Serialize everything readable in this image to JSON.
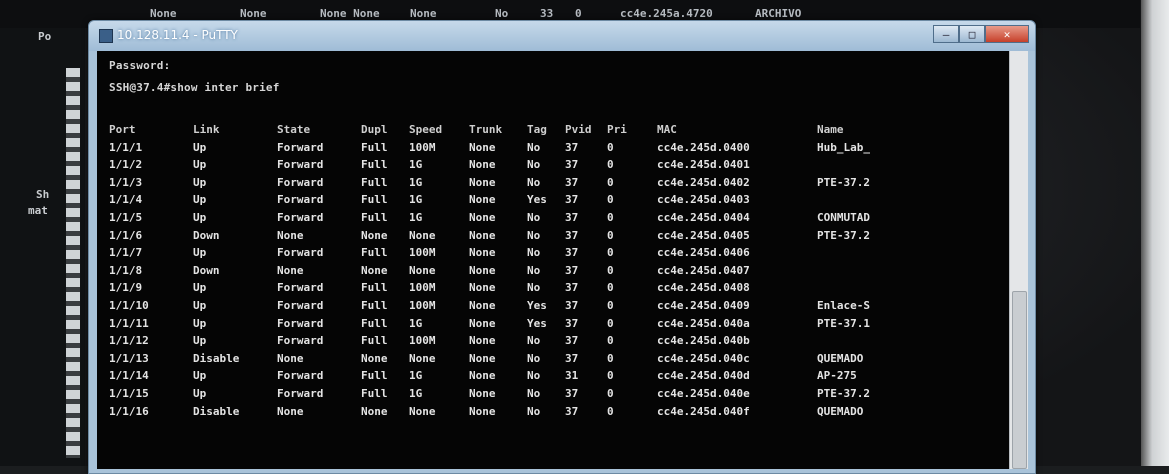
{
  "background_strip": [
    "None",
    "None",
    "None None",
    "None",
    "No",
    "33",
    "0",
    "cc4e.245a.4720",
    "ARCHIVO"
  ],
  "background_left": {
    "top_label": "Po",
    "mid_label_1": "Sh",
    "mid_label_2": "mat"
  },
  "window": {
    "title": "10.128.11.4 - PuTTY",
    "controls": {
      "minimize": "–",
      "maximize": "□",
      "close": "✕"
    }
  },
  "terminal": {
    "password_line": "Password:",
    "command_line": "SSH@37.4#show inter brief",
    "columns": [
      "Port",
      "Link",
      "State",
      "Dupl",
      "Speed",
      "Trunk",
      "Tag",
      "Pvid",
      "Pri",
      "MAC",
      "Name"
    ],
    "rows": [
      [
        "1/1/1",
        "Up",
        "Forward",
        "Full",
        "100M",
        "None",
        "No",
        "37",
        "0",
        "cc4e.245d.0400",
        "Hub_Lab_"
      ],
      [
        "1/1/2",
        "Up",
        "Forward",
        "Full",
        "1G",
        "None",
        "No",
        "37",
        "0",
        "cc4e.245d.0401",
        ""
      ],
      [
        "1/1/3",
        "Up",
        "Forward",
        "Full",
        "1G",
        "None",
        "No",
        "37",
        "0",
        "cc4e.245d.0402",
        "PTE-37.2"
      ],
      [
        "1/1/4",
        "Up",
        "Forward",
        "Full",
        "1G",
        "None",
        "Yes",
        "37",
        "0",
        "cc4e.245d.0403",
        ""
      ],
      [
        "1/1/5",
        "Up",
        "Forward",
        "Full",
        "1G",
        "None",
        "No",
        "37",
        "0",
        "cc4e.245d.0404",
        "CONMUTAD"
      ],
      [
        "1/1/6",
        "Down",
        "None",
        "None",
        "None",
        "None",
        "No",
        "37",
        "0",
        "cc4e.245d.0405",
        "PTE-37.2"
      ],
      [
        "1/1/7",
        "Up",
        "Forward",
        "Full",
        "100M",
        "None",
        "No",
        "37",
        "0",
        "cc4e.245d.0406",
        ""
      ],
      [
        "1/1/8",
        "Down",
        "None",
        "None",
        "None",
        "None",
        "No",
        "37",
        "0",
        "cc4e.245d.0407",
        ""
      ],
      [
        "1/1/9",
        "Up",
        "Forward",
        "Full",
        "100M",
        "None",
        "No",
        "37",
        "0",
        "cc4e.245d.0408",
        ""
      ],
      [
        "1/1/10",
        "Up",
        "Forward",
        "Full",
        "100M",
        "None",
        "Yes",
        "37",
        "0",
        "cc4e.245d.0409",
        "Enlace-S"
      ],
      [
        "1/1/11",
        "Up",
        "Forward",
        "Full",
        "1G",
        "None",
        "Yes",
        "37",
        "0",
        "cc4e.245d.040a",
        "PTE-37.1"
      ],
      [
        "1/1/12",
        "Up",
        "Forward",
        "Full",
        "100M",
        "None",
        "No",
        "37",
        "0",
        "cc4e.245d.040b",
        ""
      ],
      [
        "1/1/13",
        "Disable",
        "None",
        "None",
        "None",
        "None",
        "No",
        "37",
        "0",
        "cc4e.245d.040c",
        "QUEMADO"
      ],
      [
        "1/1/14",
        "Up",
        "Forward",
        "Full",
        "1G",
        "None",
        "No",
        "31",
        "0",
        "cc4e.245d.040d",
        "AP-275"
      ],
      [
        "1/1/15",
        "Up",
        "Forward",
        "Full",
        "1G",
        "None",
        "No",
        "37",
        "0",
        "cc4e.245d.040e",
        "PTE-37.2"
      ],
      [
        "1/1/16",
        "Disable",
        "None",
        "None",
        "None",
        "None",
        "No",
        "37",
        "0",
        "cc4e.245d.040f",
        "QUEMADO"
      ]
    ]
  }
}
